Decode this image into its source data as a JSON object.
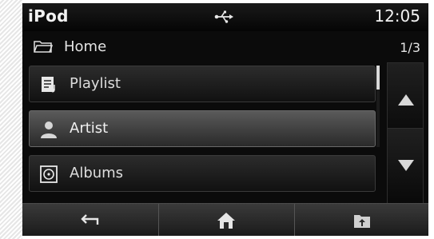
{
  "status_bar": {
    "app_title": "iPod",
    "usb_icon": "usb-icon",
    "clock": "12:05"
  },
  "path_bar": {
    "folder_icon": "folder-icon",
    "location": "Home",
    "page_indicator": "1/3"
  },
  "list": {
    "items": [
      {
        "label": "Playlist",
        "icon": "playlist-icon",
        "selected": false
      },
      {
        "label": "Artist",
        "icon": "artist-icon",
        "selected": true
      },
      {
        "label": "Albums",
        "icon": "album-icon",
        "selected": false
      }
    ]
  },
  "scroll": {
    "position_fraction": 0.0
  },
  "side_nav": {
    "up_icon": "arrow-up-icon",
    "down_icon": "arrow-down-icon"
  },
  "bottom_bar": {
    "buttons": [
      {
        "icon": "back-icon"
      },
      {
        "icon": "home-icon"
      },
      {
        "icon": "folder-up-icon"
      }
    ]
  },
  "colors": {
    "background": "#0b0b0b",
    "text": "#f2f2f2",
    "selected_item": "#4a4a4a"
  }
}
